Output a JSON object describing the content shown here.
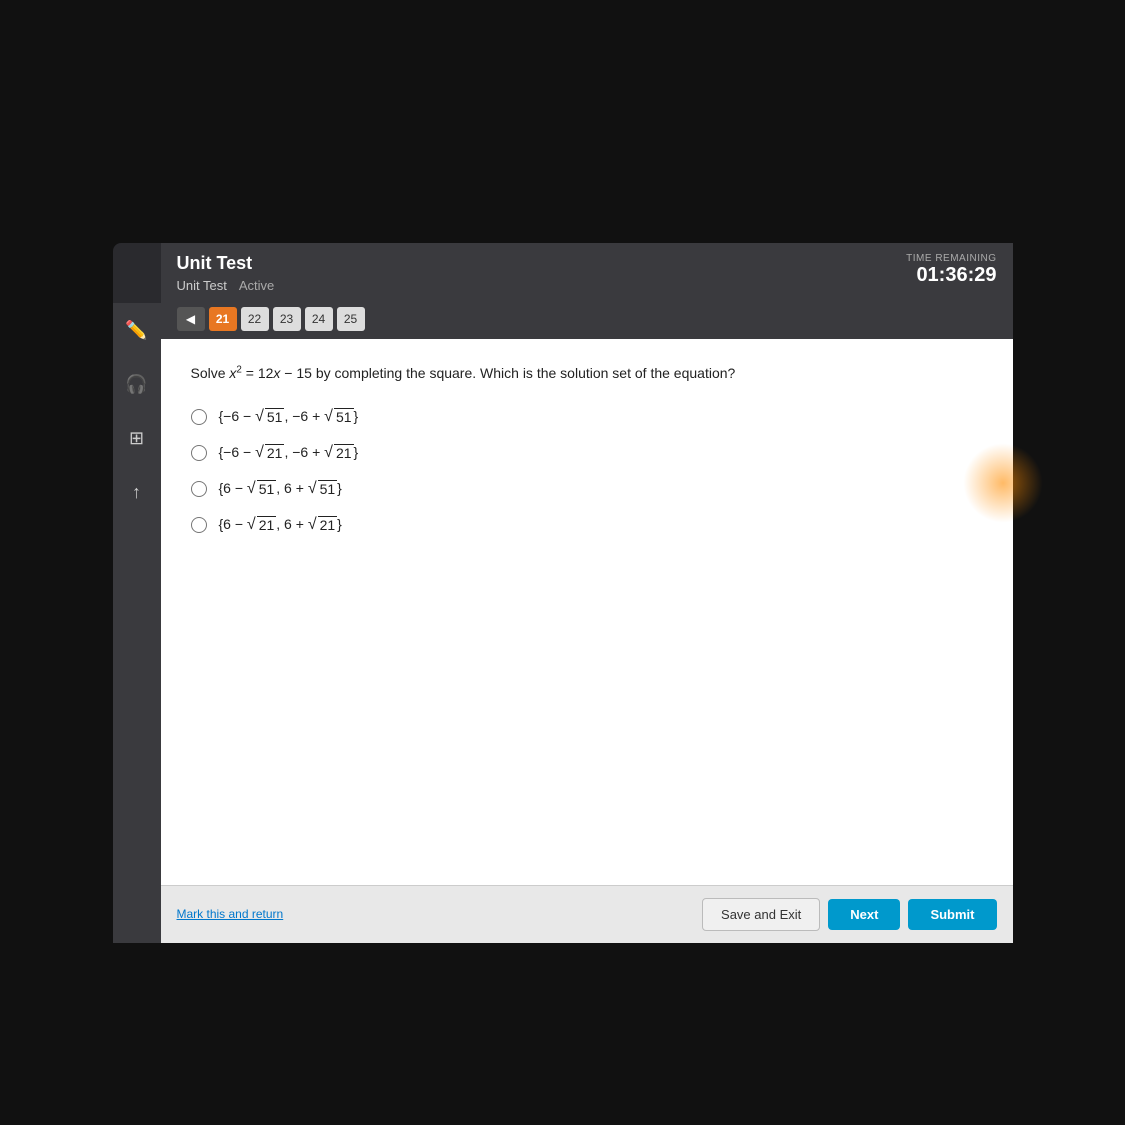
{
  "header": {
    "title": "Unit Test",
    "subtitle": "Unit Test",
    "status": "Active",
    "time_label": "TIME REMAINING",
    "time_value": "01:36:29"
  },
  "navigation": {
    "arrow_label": "◀",
    "question_numbers": [
      "21",
      "22",
      "23",
      "24",
      "25"
    ],
    "current_question": "21"
  },
  "question": {
    "text": "Solve x² = 12x − 15 by completing the square. Which is the solution set of the equation?",
    "options": [
      "{−6 − √51, −6 + √51}",
      "{−6 − √21, −6 + √21}",
      "{6 − √51, 6 + √51}",
      "{6 − √21, 6 + √21}"
    ]
  },
  "footer": {
    "mark_return": "Mark this and return",
    "save_exit": "Save and Exit",
    "next": "Next",
    "submit": "Submit"
  },
  "sidebar": {
    "icons": [
      "pencil",
      "headphones",
      "calculator",
      "arrow-up"
    ]
  }
}
